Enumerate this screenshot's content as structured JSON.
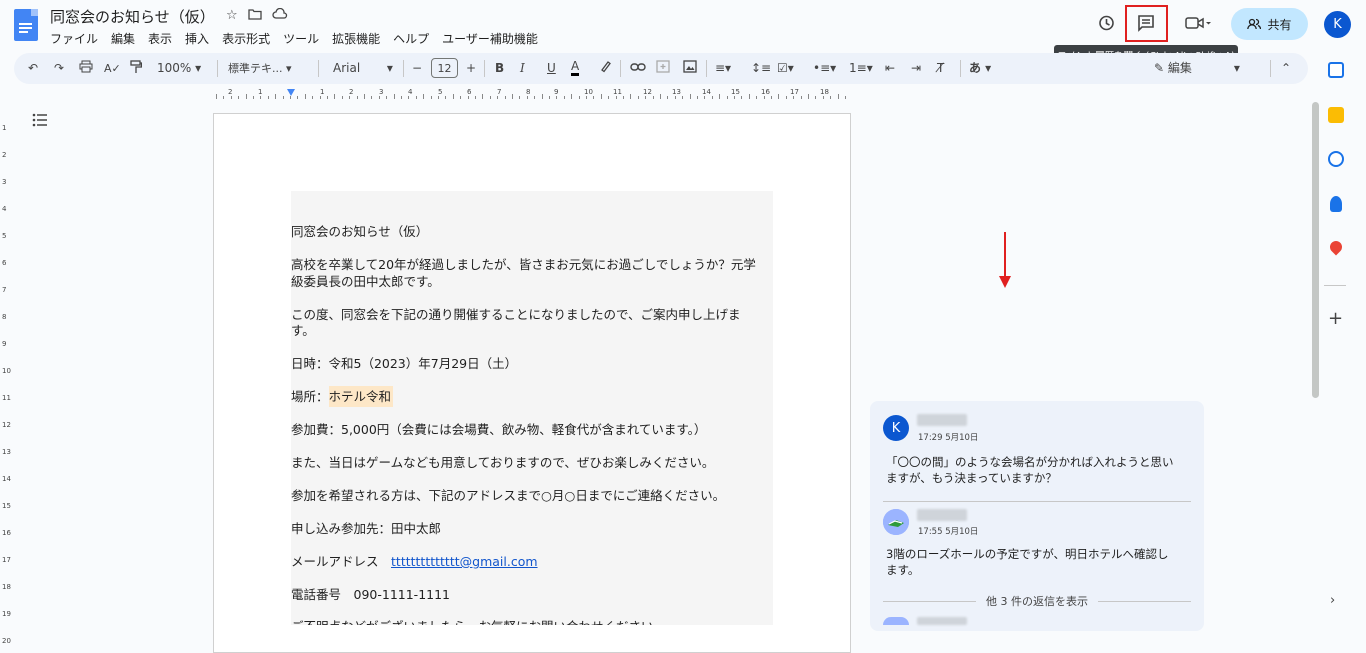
{
  "app": {
    "doc_title": "同窓会のお知らせ（仮）",
    "menu": [
      "ファイル",
      "編集",
      "表示",
      "挿入",
      "表示形式",
      "ツール",
      "拡張機能",
      "ヘルプ",
      "ユーザー補助機能"
    ],
    "share_label": "共有",
    "avatar_letter": "K",
    "tooltip": "コメント履歴を開く (Ctrl+Alt+Shift+A)"
  },
  "toolbar": {
    "zoom": "100%",
    "style": "標準テキ...",
    "font": "Arial",
    "font_size": "12",
    "mode": "編集"
  },
  "ruler": {
    "numbers": [
      "2",
      "1",
      "1",
      "2",
      "3",
      "4",
      "5",
      "6",
      "7",
      "8",
      "9",
      "10",
      "11",
      "12",
      "13",
      "14",
      "15",
      "16",
      "17",
      "18"
    ]
  },
  "vruler": [
    "1",
    "2",
    "3",
    "4",
    "5",
    "6",
    "7",
    "8",
    "9",
    "10",
    "11",
    "12",
    "13",
    "14",
    "15",
    "16",
    "17",
    "18",
    "19",
    "20"
  ],
  "document": {
    "lines": [
      "同窓会のお知らせ（仮）",
      "高校を卒業して20年が経過しましたが、皆さまお元気にお過ごしでしょうか？元学",
      "級委員長の田中太郎です。",
      "この度、同窓会を下記の通り開催することになりましたので、ご案内申し上げま",
      "す。",
      "日時：令和5（2023）年7月29日（土）"
    ],
    "place_label": " 場所：",
    "place_value": "ホテル令和",
    "fee": " 参加費：5,000円（会費には会場費、飲み物、軽食代が含まれています。）",
    "games": "また、当日はゲームなども用意しておりますので、ぜひお楽しみください。",
    "rsvp": "参加を希望される方は、下記のアドレスまで○月○日までにご連絡ください。",
    "contact": "申し込み参加先：田中太郎",
    "mail_label": "メールアドレス　",
    "mail": "tttttttttttttt@gmail.com",
    "phone": "電話番号　090-1111-1111",
    "last": "ご不明点などがございましたら、お気軽にお問い合わせください。"
  },
  "comments": {
    "first": {
      "avatar": "K",
      "time": "17:29 5月10日",
      "text1": "「〇〇の間」のような会場名が分かれば入れようと思い",
      "text2": "ますが、もう決まっていますか？"
    },
    "second": {
      "time": "17:55 5月10日",
      "text1": "3階のローズホールの予定ですが、明日ホテルへ確認し",
      "text2": "ます。"
    },
    "more": "他 3 件の返信を表示"
  },
  "colors": {
    "accent": "#0b57d0",
    "highlight": "#fde7c7",
    "red": "#e02020"
  }
}
